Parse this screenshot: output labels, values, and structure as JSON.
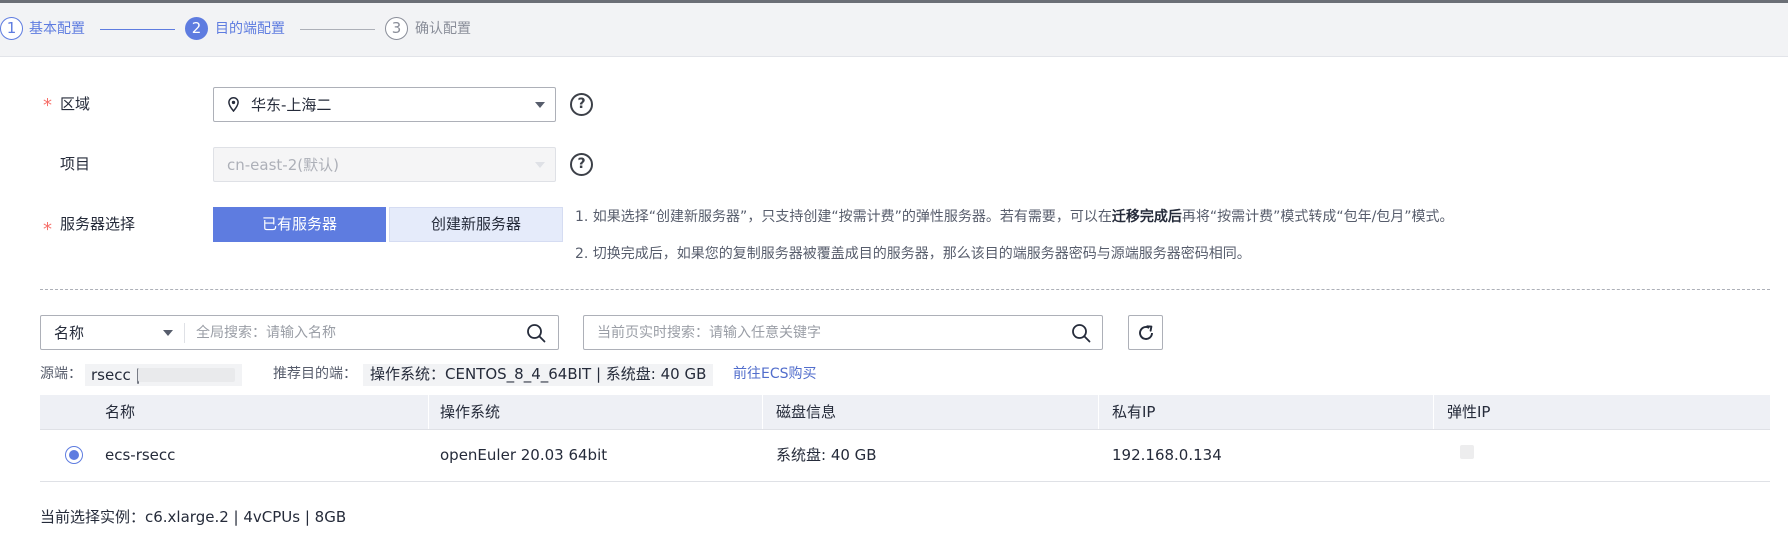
{
  "steps": [
    {
      "number": "1",
      "label": "基本配置",
      "state": "done"
    },
    {
      "number": "2",
      "label": "目的端配置",
      "state": "active"
    },
    {
      "number": "3",
      "label": "确认配置",
      "state": "todo"
    }
  ],
  "form": {
    "region": {
      "required_mark": "*",
      "label": "区域",
      "value": "华东-上海二",
      "help": "?"
    },
    "project": {
      "label": "项目",
      "value": "cn-east-2(默认)",
      "help": "?"
    },
    "server": {
      "required_mark": "*",
      "label": "服务器选择",
      "options": [
        "已有服务器",
        "创建新服务器"
      ],
      "selected": "已有服务器",
      "note1_pre": "1. 如果选择“创建新服务器”，只支持创建“按需计费”的弹性服务器。若有需要，可以在",
      "note1_bold": "迁移完成后",
      "note1_post": "再将“按需计费”模式转成“包年/包月”模式。",
      "note2": "2. 切换完成后，如果您的复制服务器被覆盖成目的服务器，那么该目的端服务器密码与源端服务器密码相同。"
    }
  },
  "search": {
    "field_select": "名称",
    "global_placeholder": "全局搜索：请输入名称",
    "page_placeholder": "当前页实时搜索：请输入任意关键字"
  },
  "info": {
    "source_label": "源端：",
    "source_value": "rsecc |",
    "recommend_label": "推荐目的端：",
    "recommend_value": "操作系统：CENTOS_8_4_64BIT | 系统盘: 40 GB",
    "buy_link": "前往ECS购买"
  },
  "table": {
    "columns": [
      "名称",
      "操作系统",
      "磁盘信息",
      "私有IP",
      "弹性IP"
    ],
    "rows": [
      {
        "name": "ecs-rsecc",
        "os": "openEuler 20.03 64bit",
        "disk": "系统盘: 40 GB",
        "private_ip": "192.168.0.134",
        "eip": "",
        "selected": true
      }
    ]
  },
  "footer": {
    "selected_instance": "当前选择实例：c6.xlarge.2 | 4vCPUs | 8GB"
  },
  "colors": {
    "primary": "#5e7ce0",
    "required": "#f66f6a",
    "link": "#526ecc"
  }
}
